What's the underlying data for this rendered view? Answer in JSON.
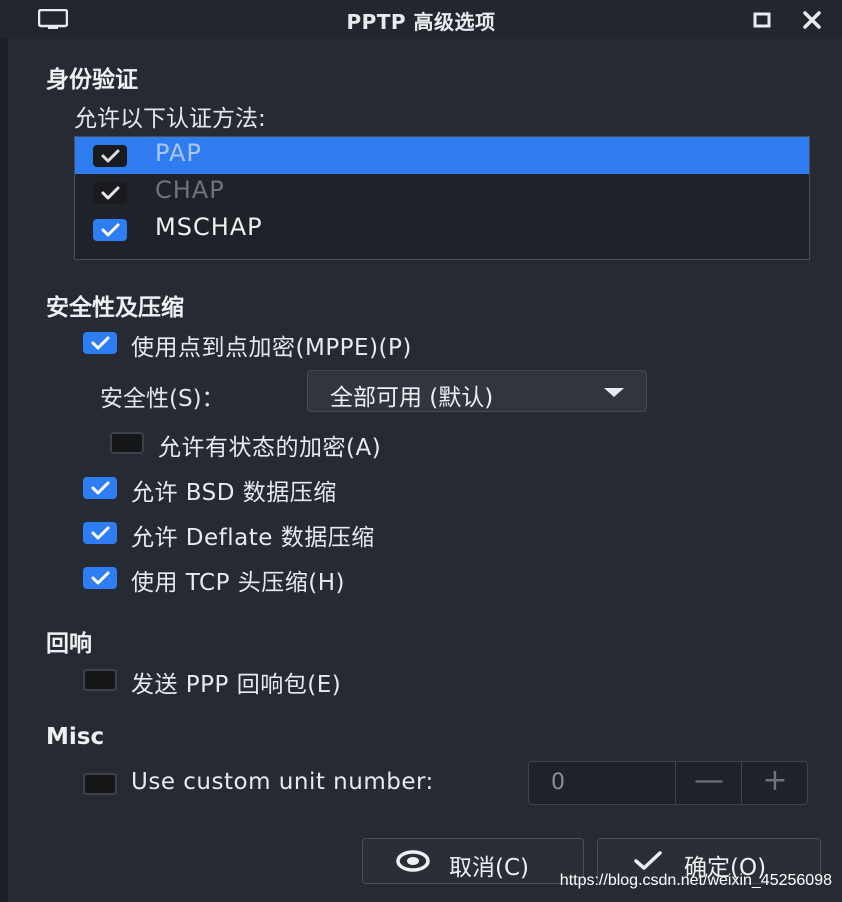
{
  "window": {
    "title": "PPTP 高级选项",
    "controls": [
      "maximize-icon",
      "close-icon"
    ]
  },
  "auth": {
    "section_title": "身份验证",
    "prompt": "允许以下认证方法:",
    "methods": [
      {
        "label": "PAP",
        "checked": true,
        "selected": true
      },
      {
        "label": "CHAP",
        "checked": true,
        "selected": false
      },
      {
        "label": "MSCHAP",
        "checked": true,
        "selected": false
      }
    ]
  },
  "security": {
    "section_title": "安全性及压缩",
    "mppe_label": "使用点到点加密(MPPE)(P)",
    "mppe_checked": true,
    "security_label": "安全性(S)：",
    "security_value": "全部可用 (默认)",
    "stateful_label": "允许有状态的加密(A)",
    "stateful_checked": false,
    "bsd_label": "允许 BSD 数据压缩",
    "bsd_checked": true,
    "deflate_label": "允许 Deflate 数据压缩",
    "deflate_checked": true,
    "tcp_label": "使用 TCP 头压缩(H)",
    "tcp_checked": true
  },
  "echo": {
    "section_title": "回响",
    "send_label": "发送 PPP 回响包(E)",
    "send_checked": false
  },
  "misc": {
    "section_title": "Misc",
    "unit_label": "Use custom unit number:",
    "unit_checked": false,
    "unit_value": "0",
    "minus_glyph": "—",
    "plus_glyph": "+"
  },
  "buttons": {
    "cancel_label": "取消(C)",
    "ok_label": "确定(O)"
  },
  "colors": {
    "accent": "#2f7df2",
    "background": "#262a33"
  },
  "watermark": "https://blog.csdn.net/weixin_45256098"
}
